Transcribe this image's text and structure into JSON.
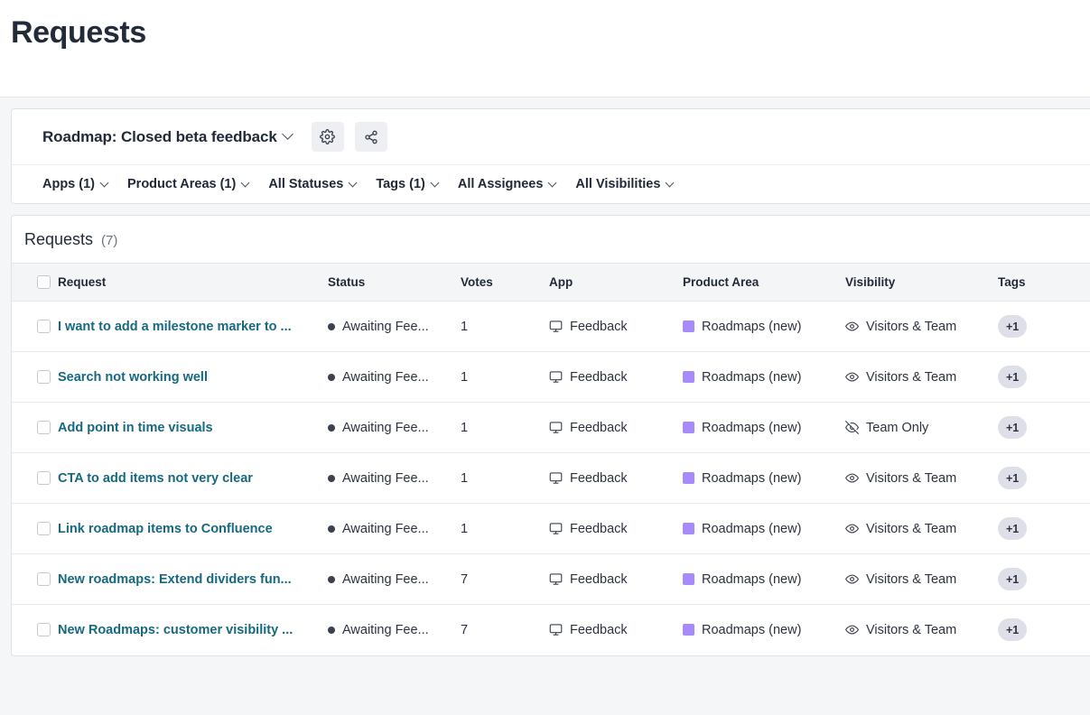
{
  "page": {
    "title": "Requests"
  },
  "toolbar": {
    "board_name": "Roadmap: Closed beta feedback",
    "settings_button_icon": "gear-icon",
    "share_button_icon": "share-icon",
    "filters": [
      {
        "label": "Apps (1)"
      },
      {
        "label": "Product Areas (1)"
      },
      {
        "label": "All Statuses"
      },
      {
        "label": "Tags (1)"
      },
      {
        "label": "All Assignees"
      },
      {
        "label": "All Visibilities"
      }
    ]
  },
  "table": {
    "heading": "Requests",
    "count": "(7)",
    "columns": [
      {
        "key": "check",
        "label": ""
      },
      {
        "key": "request",
        "label": "Request"
      },
      {
        "key": "status",
        "label": "Status"
      },
      {
        "key": "votes",
        "label": "Votes"
      },
      {
        "key": "app",
        "label": "App"
      },
      {
        "key": "area",
        "label": "Product Area"
      },
      {
        "key": "vis",
        "label": "Visibility"
      },
      {
        "key": "tags",
        "label": "Tags"
      }
    ],
    "rows": [
      {
        "request": "I want to add a milestone marker to ...",
        "status": "Awaiting Fee...",
        "votes": "1",
        "app": "Feedback",
        "area": "Roadmaps (new)",
        "visibility": "Visitors & Team",
        "visibility_icon": "eye-icon",
        "tags": "+1"
      },
      {
        "request": "Search not working well",
        "status": "Awaiting Fee...",
        "votes": "1",
        "app": "Feedback",
        "area": "Roadmaps (new)",
        "visibility": "Visitors & Team",
        "visibility_icon": "eye-icon",
        "tags": "+1"
      },
      {
        "request": "Add point in time visuals",
        "status": "Awaiting Fee...",
        "votes": "1",
        "app": "Feedback",
        "area": "Roadmaps (new)",
        "visibility": "Team Only",
        "visibility_icon": "eye-off-icon",
        "tags": "+1"
      },
      {
        "request": "CTA to add items not very clear",
        "status": "Awaiting Fee...",
        "votes": "1",
        "app": "Feedback",
        "area": "Roadmaps (new)",
        "visibility": "Visitors & Team",
        "visibility_icon": "eye-icon",
        "tags": "+1"
      },
      {
        "request": "Link roadmap items to Confluence",
        "status": "Awaiting Fee...",
        "votes": "1",
        "app": "Feedback",
        "area": "Roadmaps (new)",
        "visibility": "Visitors & Team",
        "visibility_icon": "eye-icon",
        "tags": "+1"
      },
      {
        "request": "New roadmaps: Extend dividers fun...",
        "status": "Awaiting Fee...",
        "votes": "7",
        "app": "Feedback",
        "area": "Roadmaps (new)",
        "visibility": "Visitors & Team",
        "visibility_icon": "eye-icon",
        "tags": "+1"
      },
      {
        "request": "New Roadmaps: customer visibility ...",
        "status": "Awaiting Fee...",
        "votes": "7",
        "app": "Feedback",
        "area": "Roadmaps (new)",
        "visibility": "Visitors & Team",
        "visibility_icon": "eye-icon",
        "tags": "+1"
      }
    ]
  },
  "colors": {
    "link": "#16697f",
    "product_area_swatch": "#a78bfa",
    "status_dot": "#3b414e",
    "tag_pill_bg": "#dedfe8",
    "canvas_bg": "#f5f6f8"
  }
}
